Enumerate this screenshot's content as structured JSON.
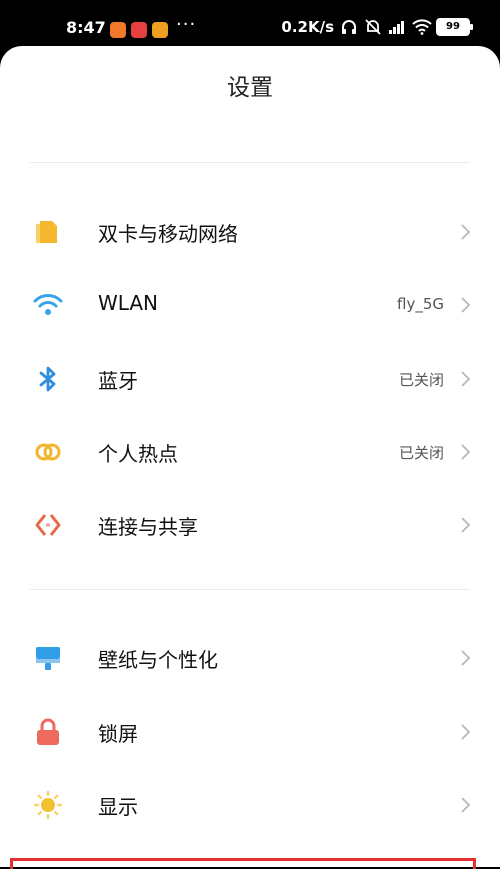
{
  "status": {
    "time": "8:47",
    "dots": "···",
    "speed": "0.2K/s",
    "battery": "99"
  },
  "header": {
    "title": "设置"
  },
  "group1": [
    {
      "label": "双卡与移动网络",
      "value": "",
      "icon": "sim-card-icon"
    },
    {
      "label": "WLAN",
      "value": "fly_5G",
      "icon": "wifi-icon"
    },
    {
      "label": "蓝牙",
      "value": "已关闭",
      "icon": "bluetooth-icon"
    },
    {
      "label": "个人热点",
      "value": "已关闭",
      "icon": "hotspot-icon"
    },
    {
      "label": "连接与共享",
      "value": "",
      "icon": "connection-share-icon"
    }
  ],
  "group2": [
    {
      "label": "壁纸与个性化",
      "icon": "wallpaper-icon"
    },
    {
      "label": "锁屏",
      "icon": "lock-icon"
    },
    {
      "label": "显示",
      "icon": "display-brightness-icon"
    }
  ],
  "colors": {
    "sim": "#f5b82e",
    "wifi": "#3aa3e8",
    "bluetooth": "#2e8ee0",
    "hotspot": "#f3b52b",
    "share": "#e5674c",
    "wallpaper": "#2f9ee8",
    "lock": "#ec6a5e",
    "display": "#f3c12d"
  }
}
